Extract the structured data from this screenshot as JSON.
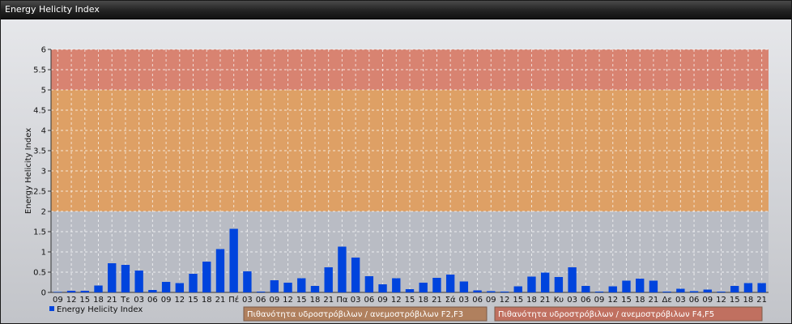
{
  "window": {
    "title": "Energy Helicity Index"
  },
  "chart_data": {
    "type": "bar",
    "title": "",
    "ylabel": "Energy Helicity Index",
    "ylim": [
      0,
      6
    ],
    "yticks": [
      "0",
      "0.5",
      "1",
      "1.5",
      "2",
      "2.5",
      "3",
      "3.5",
      "4",
      "4.5",
      "5",
      "5.5",
      "6"
    ],
    "grid": true,
    "categories": [
      "09",
      "12",
      "15",
      "18",
      "21",
      "Τε",
      "03",
      "06",
      "09",
      "12",
      "15",
      "18",
      "21",
      "Πέ",
      "03",
      "06",
      "09",
      "12",
      "15",
      "18",
      "21",
      "Πα",
      "03",
      "06",
      "09",
      "12",
      "15",
      "18",
      "21",
      "Σά",
      "03",
      "06",
      "09",
      "12",
      "15",
      "18",
      "21",
      "Κυ",
      "03",
      "06",
      "09",
      "12",
      "15",
      "18",
      "21",
      "Δε",
      "03",
      "06",
      "09",
      "12",
      "15",
      "18",
      "21"
    ],
    "series": [
      {
        "name": "Energy Helicity Index",
        "color": "#0044dd",
        "values": [
          0.01,
          0.04,
          0.04,
          0.17,
          0.72,
          0.68,
          0.54,
          0.06,
          0.26,
          0.23,
          0.46,
          0.76,
          1.07,
          1.57,
          0.52,
          0.02,
          0.3,
          0.24,
          0.35,
          0.16,
          0.62,
          1.13,
          0.86,
          0.4,
          0.2,
          0.35,
          0.08,
          0.24,
          0.36,
          0.44,
          0.27,
          0.05,
          0.03,
          0.02,
          0.15,
          0.39,
          0.49,
          0.38,
          0.62,
          0.16,
          0.02,
          0.15,
          0.29,
          0.34,
          0.29,
          0.02,
          0.09,
          0.03,
          0.07,
          0.02,
          0.16,
          0.23,
          0.23
        ]
      }
    ],
    "zones": [
      {
        "label": "Πιθανότητα υδροστρόβιλων / ανεμοστρόβιλων F2,F3",
        "from": 2,
        "to": 5,
        "color": "#e8994a"
      },
      {
        "label": "Πιθανότητα υδροστρόβιλων / ανεμοστρόβιλων F4,F5",
        "from": 5,
        "to": 6,
        "color": "#e0735a"
      }
    ],
    "legend": {
      "position": "bottom-left"
    },
    "zone_legend_colors": [
      "#b0805e",
      "#c07060"
    ]
  }
}
